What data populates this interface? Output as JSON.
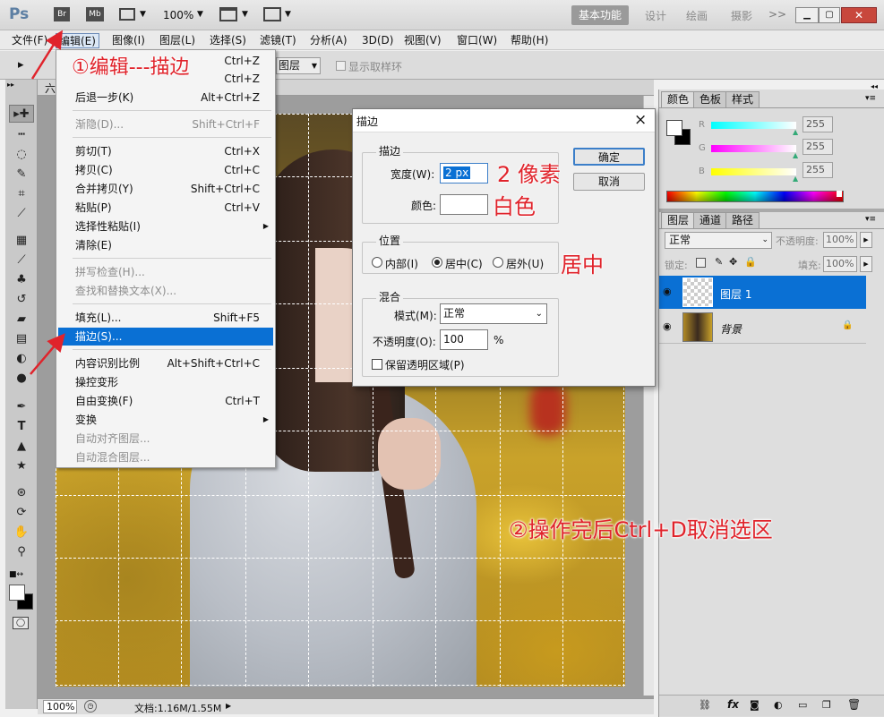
{
  "app": {
    "logo": "Ps",
    "launcher_icons": [
      "Br",
      "Mb"
    ],
    "zoom": "100%",
    "workspaces": [
      "基本功能",
      "设计",
      "绘画",
      "摄影"
    ],
    "more": ">>"
  },
  "menubar": [
    "文件(F)",
    "编辑(E)",
    "图像(I)",
    "图层(L)",
    "选择(S)",
    "滤镜(T)",
    "分析(A)",
    "3D(D)",
    "视图(V)",
    "窗口(W)",
    "帮助(H)"
  ],
  "options": {
    "sample_value": "图层",
    "show_ring": "显示取样环"
  },
  "doc_tab_fragment": "六",
  "edit_menu": {
    "items": [
      {
        "label": "",
        "shortcut": "Ctrl+Z",
        "disabled": false
      },
      {
        "label": "",
        "shortcut": "Ctrl+Z",
        "disabled": false
      },
      {
        "label": "后退一步(K)",
        "shortcut": "Alt+Ctrl+Z",
        "disabled": false
      },
      {
        "label": "渐隐(D)...",
        "shortcut": "Shift+Ctrl+F",
        "disabled": true
      },
      {
        "label": "剪切(T)",
        "shortcut": "Ctrl+X",
        "disabled": false
      },
      {
        "label": "拷贝(C)",
        "shortcut": "Ctrl+C",
        "disabled": false
      },
      {
        "label": "合并拷贝(Y)",
        "shortcut": "Shift+Ctrl+C",
        "disabled": false
      },
      {
        "label": "粘贴(P)",
        "shortcut": "Ctrl+V",
        "disabled": false
      },
      {
        "label": "选择性粘贴(I)",
        "shortcut": "",
        "disabled": false,
        "submenu": true
      },
      {
        "label": "清除(E)",
        "shortcut": "",
        "disabled": false
      },
      {
        "label": "拼写检查(H)...",
        "shortcut": "",
        "disabled": true
      },
      {
        "label": "查找和替换文本(X)...",
        "shortcut": "",
        "disabled": true
      },
      {
        "label": "填充(L)...",
        "shortcut": "Shift+F5",
        "disabled": false
      },
      {
        "label": "描边(S)...",
        "shortcut": "",
        "disabled": false,
        "highlighted": true
      },
      {
        "label": "内容识别比例",
        "shortcut": "Alt+Shift+Ctrl+C",
        "disabled": false
      },
      {
        "label": "操控变形",
        "shortcut": "",
        "disabled": false
      },
      {
        "label": "自由变换(F)",
        "shortcut": "Ctrl+T",
        "disabled": false
      },
      {
        "label": "变换",
        "shortcut": "",
        "disabled": false,
        "submenu": true
      },
      {
        "label": "自动对齐图层...",
        "shortcut": "",
        "disabled": true
      },
      {
        "label": "自动混合图层...",
        "shortcut": "",
        "disabled": true
      }
    ]
  },
  "stroke_dialog": {
    "title": "描边",
    "close": "×",
    "group_stroke": "描边",
    "width_label": "宽度(W):",
    "width_value": "2 px",
    "color_label": "颜色:",
    "color_value": "#ffffff",
    "group_location": "位置",
    "loc_inside": "内部(I)",
    "loc_center": "居中(C)",
    "loc_outside": "居外(U)",
    "selected_location": "center",
    "group_blend": "混合",
    "mode_label": "模式(M):",
    "mode_value": "正常",
    "opacity_label": "不透明度(O):",
    "opacity_value": "100",
    "opacity_unit": "%",
    "preserve_label": "保留透明区域(P)",
    "preserve_checked": false,
    "ok": "确定",
    "cancel": "取消"
  },
  "annotations": {
    "step1": "①编辑---描边",
    "width": "2 像素",
    "color": "白色",
    "position": "居中",
    "step2": "②操作完后Ctrl+D取消选区",
    "color_hex": "#e0232b"
  },
  "color_panel": {
    "tabs": [
      "颜色",
      "色板",
      "样式"
    ],
    "channels": [
      {
        "label": "R",
        "value": "255"
      },
      {
        "label": "G",
        "value": "255"
      },
      {
        "label": "B",
        "value": "255"
      }
    ]
  },
  "layers_panel": {
    "tabs": [
      "图层",
      "通道",
      "路径"
    ],
    "blend": "正常",
    "opacity_label": "不透明度:",
    "opacity": "100%",
    "lock_label": "锁定:",
    "fill_label": "填充:",
    "fill": "100%",
    "layers": [
      {
        "name": "图层 1",
        "selected": true
      },
      {
        "name": "背景",
        "selected": false,
        "locked": true
      }
    ]
  },
  "status": {
    "zoom": "100%",
    "doc": "文档:1.16M/1.55M"
  }
}
